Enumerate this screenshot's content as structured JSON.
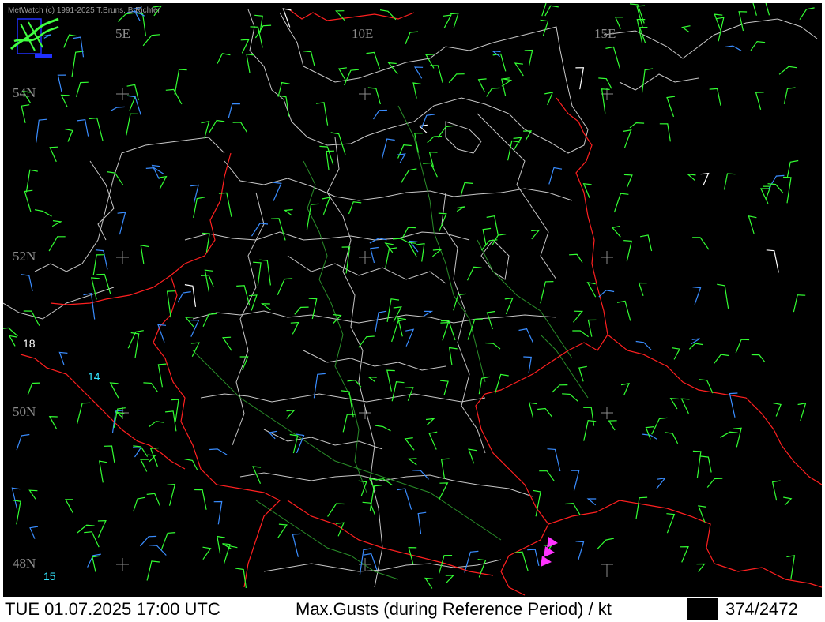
{
  "map": {
    "copyright": "MetWatch  (c) 1991-2025 T.Bruns, B.Richter",
    "logo_icon": "metwatch-logo-icon",
    "longitude_labels": [
      "5E",
      "10E",
      "15E"
    ],
    "latitude_labels": [
      "54N",
      "52N",
      "50N",
      "48N"
    ],
    "station_values": [
      {
        "value": "18",
        "color": "#ffffff"
      },
      {
        "value": "14",
        "color": "#33e6ff"
      },
      {
        "value": "15",
        "color": "#33e6ff"
      }
    ],
    "colors": {
      "background": "#000000",
      "national_border": "#ff2020",
      "state_border": "#c8c8c8",
      "rivers": "#2a8f2a",
      "graticule": "#8c8c8c",
      "barb_green": "#33ff33",
      "barb_blue": "#3a8dff",
      "barb_white": "#ffffff",
      "front_marker": "#ff33ff"
    }
  },
  "status_bar": {
    "datetime": "TUE 01.07.2025 17:00 UTC",
    "parameter": "Max.Gusts (during Reference Period) / kt",
    "count": "374/2472"
  }
}
